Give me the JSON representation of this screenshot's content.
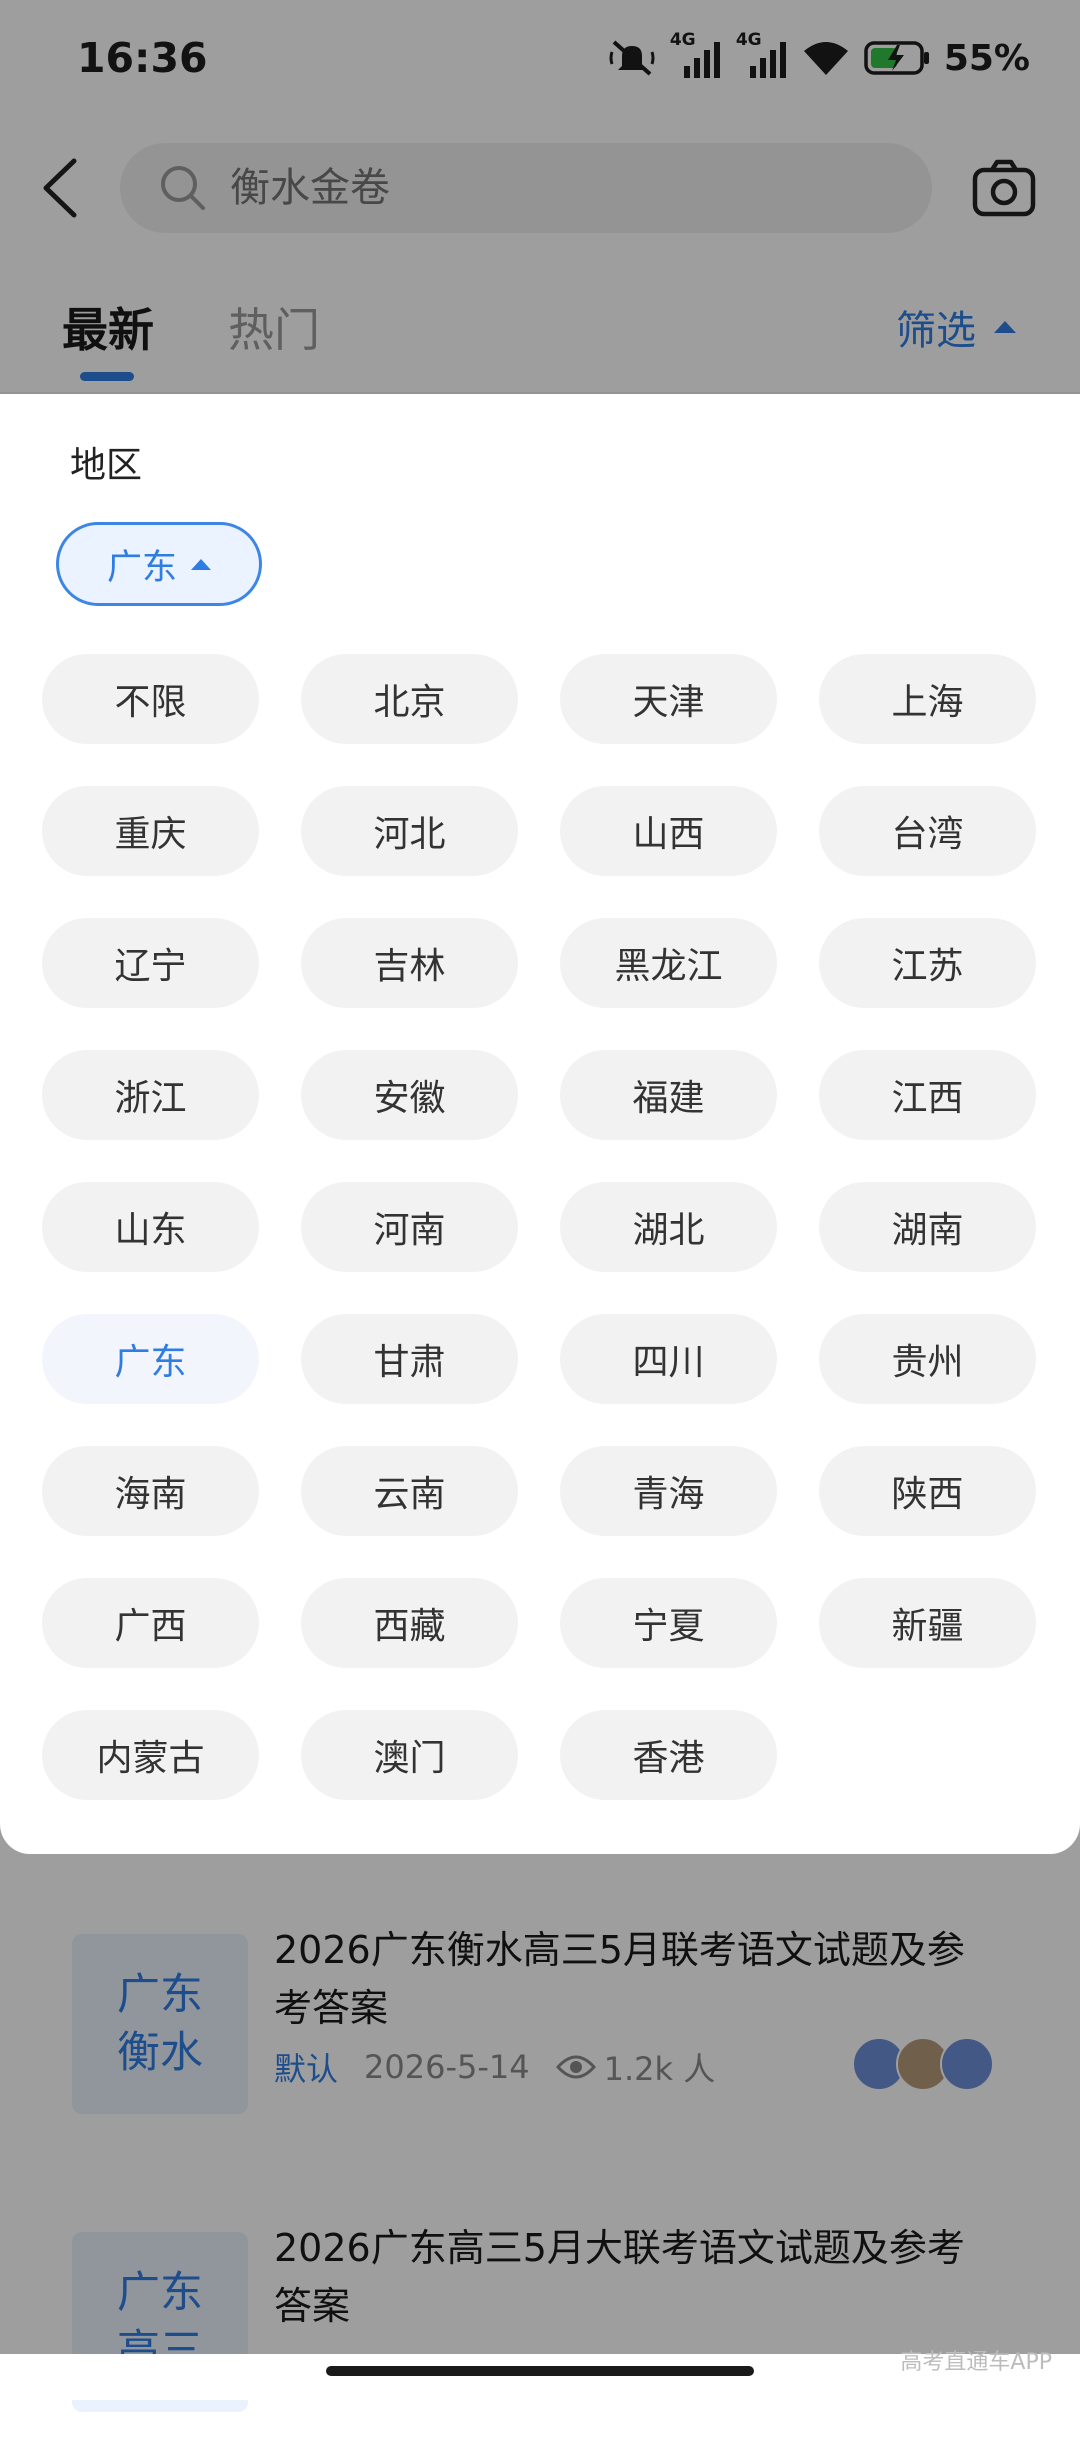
{
  "status": {
    "time": "16:36",
    "battery": "55%",
    "net1": "4G",
    "net2": "4G"
  },
  "search": {
    "placeholder": "衡水金卷"
  },
  "tabs": {
    "latest": "最新",
    "hot": "热门",
    "filter": "筛选"
  },
  "filter": {
    "region_title": "地区",
    "selected": "广东",
    "options": [
      "不限",
      "北京",
      "天津",
      "上海",
      "重庆",
      "河北",
      "山西",
      "台湾",
      "辽宁",
      "吉林",
      "黑龙江",
      "江苏",
      "浙江",
      "安徽",
      "福建",
      "江西",
      "山东",
      "河南",
      "湖北",
      "湖南",
      "广东",
      "甘肃",
      "四川",
      "贵州",
      "海南",
      "云南",
      "青海",
      "陕西",
      "广西",
      "西藏",
      "宁夏",
      "新疆",
      "内蒙古",
      "澳门",
      "香港"
    ],
    "active_index": 20
  },
  "list": [
    {
      "thumb_line1": "广东",
      "thumb_line2": "衡水",
      "title": "2026广东衡水高三5月联考语文试题及参考答案",
      "tag": "默认",
      "date": "2026-5-14",
      "views": "1.2k 人"
    },
    {
      "thumb_line1": "广东",
      "thumb_line2": "高三",
      "title": "2026广东高三5月大联考语文试题及参考答案"
    }
  ],
  "watermark": "高考直通车APP",
  "colors": {
    "accent": "#2f7de1",
    "chip_bg": "#f2f2f2",
    "overlay": "rgba(0,0,0,0.38)"
  }
}
